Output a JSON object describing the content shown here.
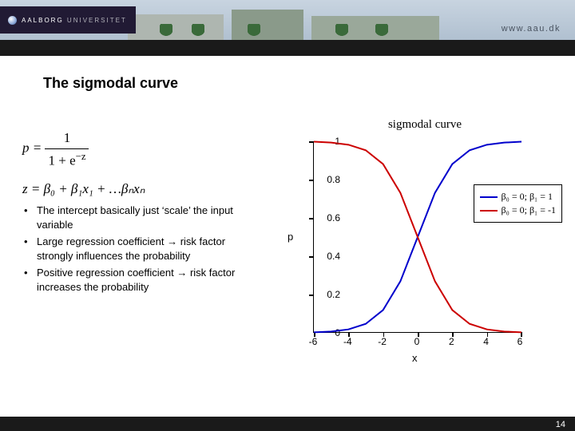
{
  "header": {
    "logo_a": "AALBORG",
    "logo_b": "UNIVERSITET",
    "url": "www.aau.dk"
  },
  "title": "The sigmodal curve",
  "formulas": {
    "p_lhs": "p =",
    "p_num": "1",
    "p_den_pre": "1 + e",
    "p_den_exp": "−z",
    "z_line": "z = β₀ + β₁x₁ + …βₙxₙ"
  },
  "bullets": [
    "The intercept basically just ‘scale’ the input variable",
    "Large regression coefficient → risk factor strongly influences the probability",
    "Positive regression coefficient → risk factor increases the probability"
  ],
  "chart_data": {
    "type": "line",
    "title": "sigmodal curve",
    "xlabel": "x",
    "ylabel": "p",
    "xlim": [
      -6,
      6
    ],
    "ylim": [
      0,
      1
    ],
    "xticks": [
      -6,
      -4,
      -2,
      0,
      2,
      4,
      6
    ],
    "yticks": [
      0,
      0.2,
      0.4,
      0.6,
      0.8,
      1
    ],
    "series": [
      {
        "name": "β₀ = 0; β₁ = 1",
        "color": "#0000cc",
        "x": [
          -6,
          -5,
          -4,
          -3,
          -2,
          -1,
          0,
          1,
          2,
          3,
          4,
          5,
          6
        ],
        "y": [
          0.0025,
          0.0067,
          0.018,
          0.047,
          0.119,
          0.269,
          0.5,
          0.731,
          0.881,
          0.953,
          0.982,
          0.993,
          0.998
        ]
      },
      {
        "name": "β₀ = 0; β₁ = -1",
        "color": "#cc0000",
        "x": [
          -6,
          -5,
          -4,
          -3,
          -2,
          -1,
          0,
          1,
          2,
          3,
          4,
          5,
          6
        ],
        "y": [
          0.998,
          0.993,
          0.982,
          0.953,
          0.881,
          0.731,
          0.5,
          0.269,
          0.119,
          0.047,
          0.018,
          0.0067,
          0.0025
        ]
      }
    ]
  },
  "legend": {
    "row1": "β₀ = 0; β₁ = 1",
    "row2": "β₀ = 0; β₁ = -1"
  },
  "axis": {
    "y0": "0",
    "y02": "0.2",
    "y04": "0.4",
    "y06": "0.6",
    "y08": "0.8",
    "y1": "1",
    "xm6": "-6",
    "xm4": "-4",
    "xm2": "-2",
    "x0": "0",
    "x2": "2",
    "x4": "4",
    "x6": "6",
    "xlabel": "x",
    "ylabel": "p"
  },
  "page": "14"
}
